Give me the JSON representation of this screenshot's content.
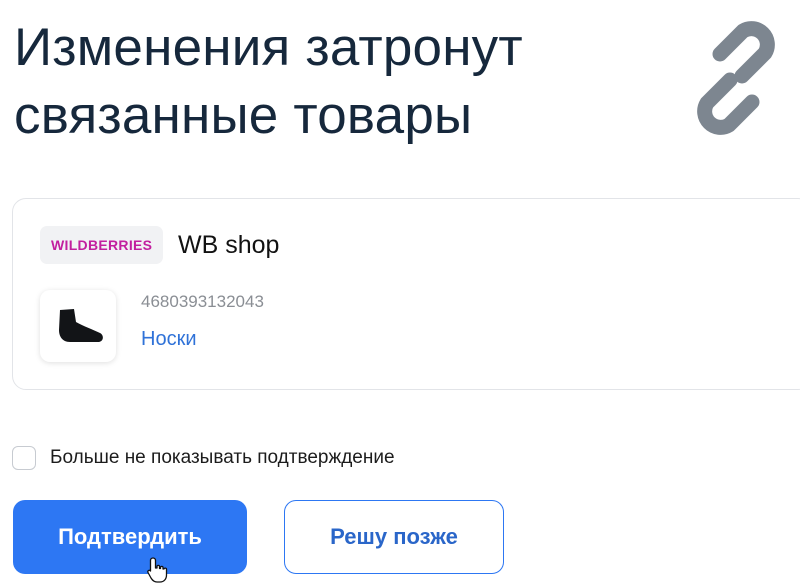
{
  "dialog": {
    "title_line1": "Изменения затронут",
    "title_line2": "связанные товары",
    "icon": "link-icon"
  },
  "product_card": {
    "marketplace_badge": "WILDBERRIES",
    "shop_name": "WB shop",
    "barcode": "4680393132043",
    "product_name": "Носки",
    "thumbnail_icon": "sock-icon"
  },
  "options": {
    "dont_show_again_label": "Больше не показывать подтверждение",
    "dont_show_again_checked": false
  },
  "actions": {
    "confirm_label": "Подтвердить",
    "later_label": "Решу позже"
  },
  "colors": {
    "accent": "#2d77f3",
    "link": "#2f72d8",
    "badge_text": "#c21f9f",
    "title": "#16283c"
  }
}
